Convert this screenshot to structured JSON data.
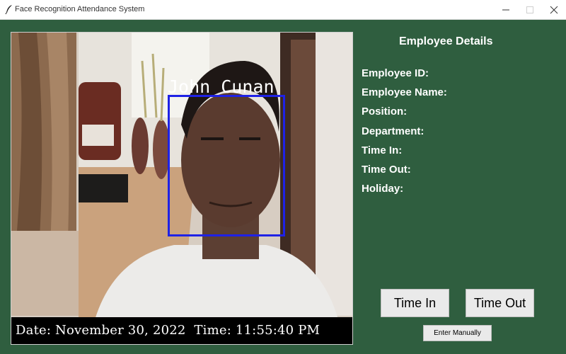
{
  "window": {
    "title": "Face Recognition Attendance System",
    "icon": "feather-icon"
  },
  "camera": {
    "recognized_name": "John Cunan",
    "datetime_text": "Date: November 30, 2022  Time: 11:55:40 PM",
    "box_color": "#1f22e6"
  },
  "details": {
    "heading": "Employee Details",
    "fields": [
      "Employee ID:",
      "Employee Name:",
      "Position:",
      "Department:",
      "Time In:",
      "Time Out:",
      "Holiday:"
    ]
  },
  "buttons": {
    "time_in": "Time In",
    "time_out": "Time Out",
    "manual": "Enter Manually"
  },
  "colors": {
    "background": "#2f5e3f",
    "button": "#eaeaea"
  }
}
